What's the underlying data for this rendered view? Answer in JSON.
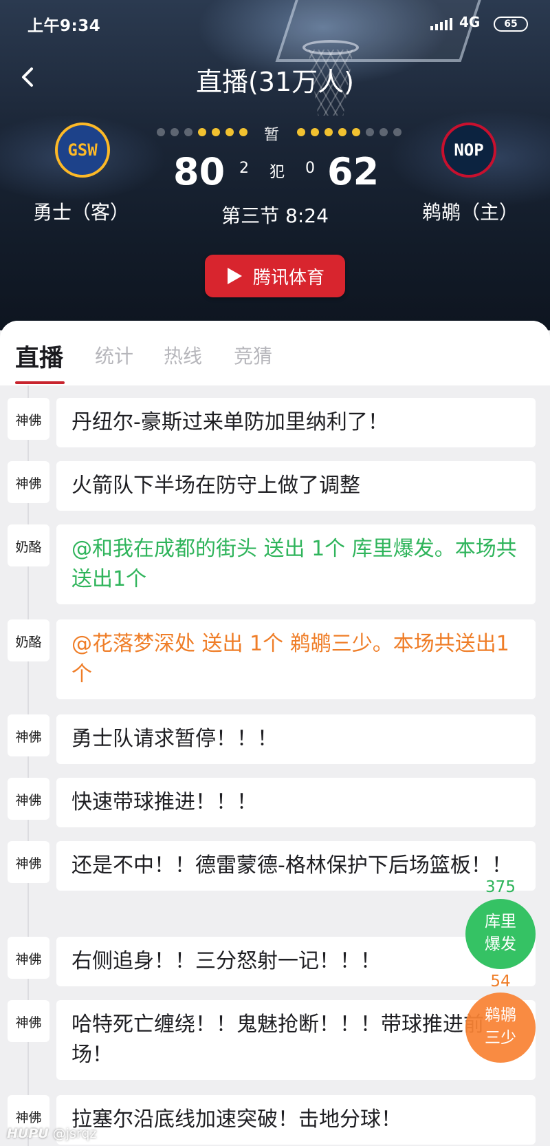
{
  "status_bar": {
    "time": "上午9:34",
    "network": "4G",
    "battery": "65"
  },
  "header": {
    "title": "直播(31万人)",
    "away": {
      "abbr": "GSW",
      "name": "勇士（客）",
      "score": "80",
      "fouls": "2"
    },
    "home": {
      "abbr": "NOP",
      "name": "鹈鹕（主）",
      "score": "62",
      "fouls": "0"
    },
    "fouls_label": "犯",
    "pause_label": "暂",
    "period": "第三节 8:24",
    "stream_button": "腾讯体育",
    "timeouts": {
      "away": [
        "#5e6672",
        "#5e6672",
        "#5e6672",
        "#f2c230",
        "#f2c230",
        "#f2c230",
        "#f2c230"
      ],
      "home": [
        "#f2c230",
        "#f2c230",
        "#f2c230",
        "#f2c230",
        "#f2c230",
        "#5e6672",
        "#5e6672",
        "#5e6672"
      ]
    }
  },
  "tabs": [
    "直播",
    "统计",
    "热线",
    "竞猜"
  ],
  "feed": [
    {
      "author": "神佛",
      "text": "丹纽尔-豪斯过来单防加里纳利了！",
      "color": "normal"
    },
    {
      "author": "神佛",
      "text": "火箭队下半场在防守上做了调整",
      "color": "normal"
    },
    {
      "author": "奶酪",
      "text": "@和我在成都的街头 送出 1个 库里爆发。本场共送出1个",
      "color": "green"
    },
    {
      "author": "奶酪",
      "text": "@花落梦深处 送出 1个 鹈鹕三少。本场共送出1个",
      "color": "orange"
    },
    {
      "author": "神佛",
      "text": "勇士队请求暂停！！！",
      "color": "normal"
    },
    {
      "author": "神佛",
      "text": "快速带球推进！！！",
      "color": "normal"
    },
    {
      "author": "神佛",
      "text": "还是不中！！德雷蒙德-格林保护下后场篮板！！",
      "color": "normal"
    },
    {
      "author": "神佛",
      "text": "右侧追身！！三分怒射一记！！！",
      "color": "normal"
    },
    {
      "author": "神佛",
      "text": "哈特死亡缠绕！！鬼魅抢断！！！带球推进前场！",
      "color": "normal"
    },
    {
      "author": "神佛",
      "text": "拉塞尔沿底线加速突破！击地分球！",
      "color": "normal"
    }
  ],
  "floating": {
    "curry": {
      "count": "375",
      "label": "库里爆发"
    },
    "pelicans": {
      "count": "54",
      "label": "鹈鹕三少"
    }
  },
  "watermark": {
    "brand": "HUPU",
    "handle": "@jsrqz"
  }
}
